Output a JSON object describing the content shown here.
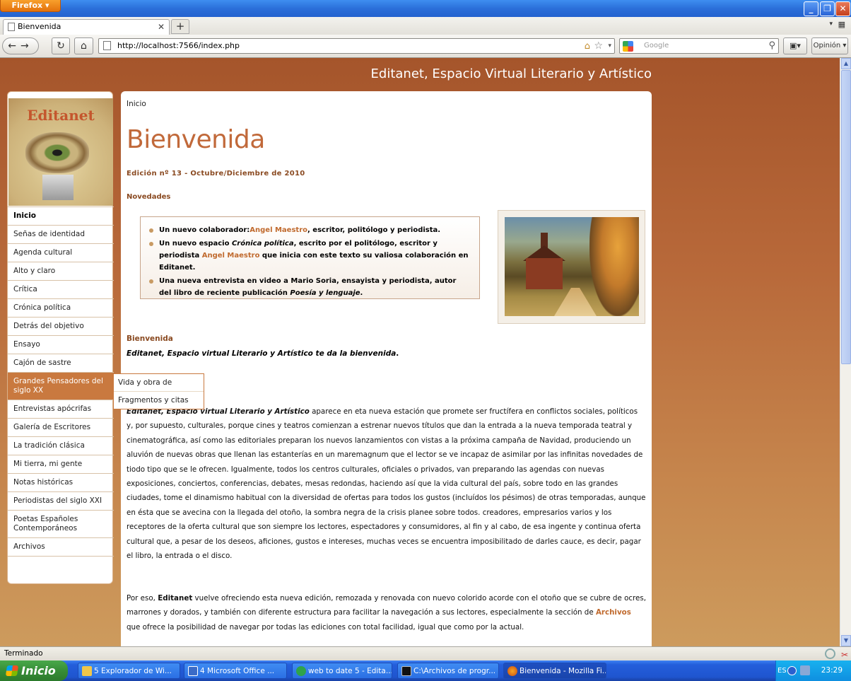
{
  "browser": {
    "menu_label": "Firefox",
    "tab_title": "Bienvenida",
    "url": "http://localhost:7566/index.php",
    "search_placeholder": "Google",
    "opinion_label": "Opinión",
    "status": "Terminado"
  },
  "site": {
    "title": "Editanet, Espacio Virtual Literario y Artístico",
    "logo_text": "Editanet"
  },
  "menu": {
    "items": [
      "Inicio",
      "Señas de identidad",
      "Agenda cultural",
      "Alto y claro",
      "Crítica",
      "Crónica política",
      "Detrás del objetivo",
      "Ensayo",
      "Cajón de sastre",
      "Grandes Pensadores del siglo XX",
      "Entrevistas apócrifas",
      "Galería de Escritores",
      "La tradición clásica",
      "Mi tierra, mi gente",
      "Notas históricas",
      "Periodistas del siglo XXI",
      "Poetas Españoles Contemporáneos",
      "Archivos"
    ],
    "submenu": [
      "Vida y obra de",
      "Fragmentos y citas"
    ]
  },
  "content": {
    "breadcrumb": "Inicio",
    "title": "Bienvenida",
    "edition": "Edición nº 13 - Octubre/Diciembre de 2010",
    "news_heading": "Novedades",
    "news": {
      "item1_pre": "Un nuevo colaborador:",
      "item1_link": "Angel Maestro",
      "item1_post": ", escritor, politólogo y periodista.",
      "item2_pre": "Un nuevo espacio ",
      "item2_em": "Crónica política",
      "item2_mid": ", escrito por el politólogo, escritor y periodista ",
      "item2_link": "Angel Maestro",
      "item2_post": " que inicia con este texto su valiosa colaboración en Editanet.",
      "item3_pre": "Una nueva entrevista en video a Mario Soria, ensayista y periodista, autor del libro de reciente publicación ",
      "item3_em": "Poesía y lenguaje",
      "item3_post": "."
    },
    "welcome_heading": "Bienvenida",
    "welcome_sub": "Editanet, Espacio virtual Literario y Artístico te da la bienvenida",
    "welcome_sub_end": ".",
    "para1_lead": "Editanet, Espacio virtual Literario y Artístico",
    "para1_body": " aparece en eta nueva estación que promete ser fructífera en conflictos sociales, políticos y, por supuesto, culturales, porque cines y teatros comienzan a estrenar nuevos títulos que dan la entrada a la nueva temporada teatral y cinematográfica, así como las editoriales preparan los nuevos lanzamientos con vistas a la próxima campaña de Navidad, produciendo un aluvión de nuevas obras que llenan las estanterías en un maremagnum que el lector se ve incapaz de asimilar por las infinitas novedades de tiodo tipo que se le ofrecen. Igualmente, todos los centros culturales, oficiales o privados, van preparando las agendas con nuevas exposiciones, conciertos, conferencias, debates, mesas redondas, haciendo así que la vida cultural del país, sobre todo en las grandes ciudades, tome el dinamismo habitual con la diversidad de ofertas para todos los gustos (incluídos los pésimos) de otras temporadas, aunque en ésta que se avecina con la llegada del otoño, la sombra negra de la crisis planee sobre todos. creadores, empresarios varios y los receptores de la oferta cultural que son siempre los lectores, espectadores y consumidores, al fin y al cabo, de esa ingente y continua oferta cultural que, a pesar de los deseos, aficiones, gustos e intereses, muchas veces se encuentra imposibilitado de darles cauce, es decir, pagar el libro, la entrada o el disco.",
    "para2_pre": "Por eso, ",
    "para2_bold": "Editanet",
    "para2_body": " vuelve ofreciendo esta nueva edición, remozada y renovada con nuevo colorido acorde con el otoño que se cubre de ocres, marrones y dorados, y también con diferente estructura para facilitar la navegación a sus lectores, especialmente la sección de ",
    "para2_link": "Archivos",
    "para2_post": " que ofrece la posibilidad de navegar por todas las ediciones con total facilidad, igual que como por la actual."
  },
  "taskbar": {
    "start_label": "Inicio",
    "tasks": [
      "5 Explorador de Wi...",
      "4 Microsoft Office ...",
      "web to date 5 - Edita...",
      "C:\\Archivos de progr...",
      "Bienvenida - Mozilla Fi..."
    ],
    "lang": "ES",
    "clock": "23:29"
  }
}
